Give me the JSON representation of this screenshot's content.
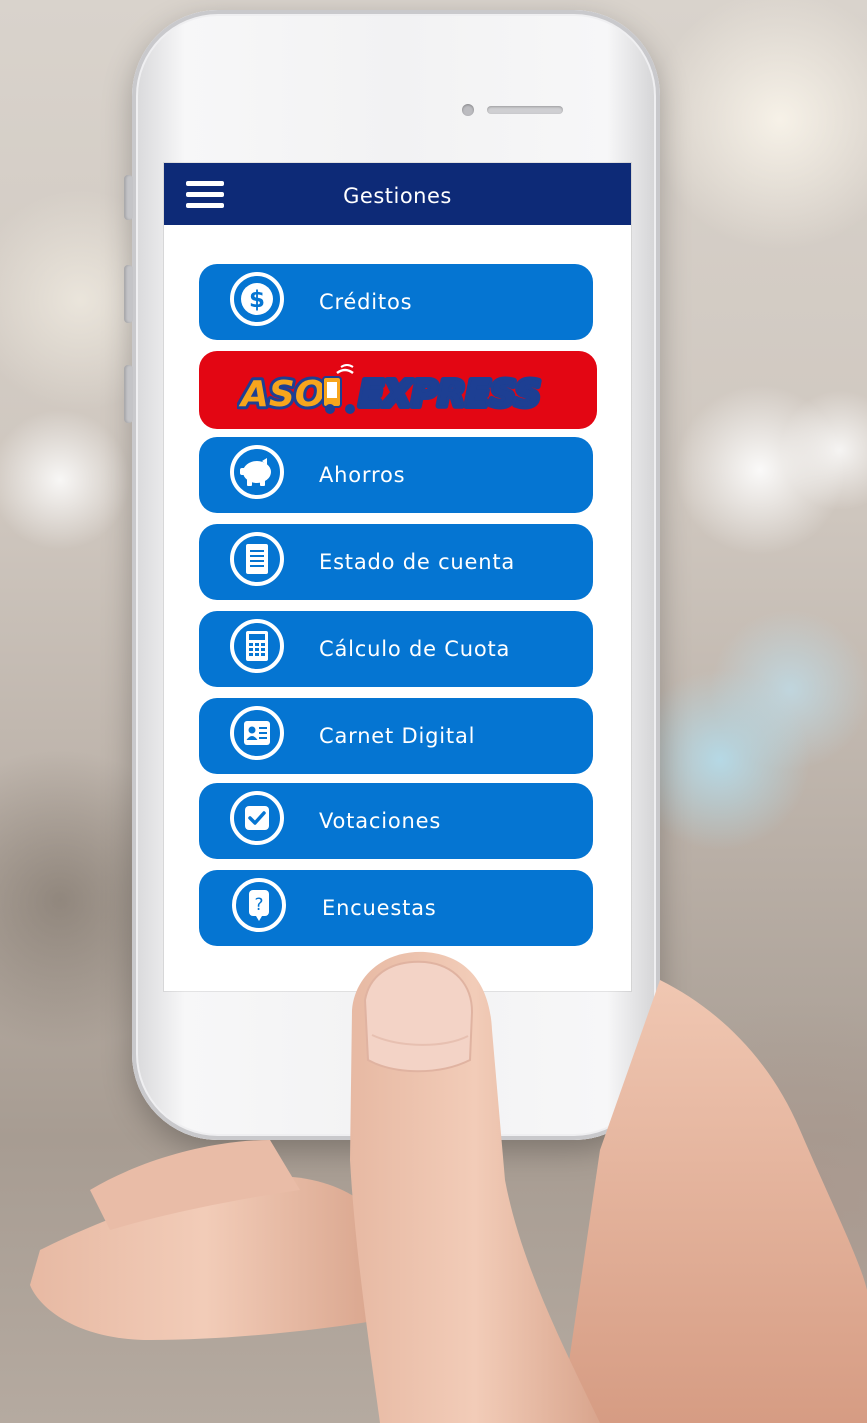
{
  "app": {
    "title": "Gestiones",
    "accent": "#0d2a77",
    "button_color": "#0575d2",
    "promo_color": "#e30613"
  },
  "promo": {
    "text": "ASOEXPRESS",
    "text_left": "ASO",
    "text_right": "EXPRESS"
  },
  "menu": {
    "items": [
      {
        "label": "Créditos",
        "icon": "dollar-icon"
      },
      {
        "label": "Ahorros",
        "icon": "piggy-bank-icon"
      },
      {
        "label": "Estado de cuenta",
        "icon": "document-icon"
      },
      {
        "label": "Cálculo de Cuota",
        "icon": "calculator-icon"
      },
      {
        "label": "Carnet Digital",
        "icon": "id-card-icon"
      },
      {
        "label": "Votaciones",
        "icon": "checkbox-icon"
      },
      {
        "label": "Encuestas",
        "icon": "question-bubble-icon"
      }
    ]
  }
}
